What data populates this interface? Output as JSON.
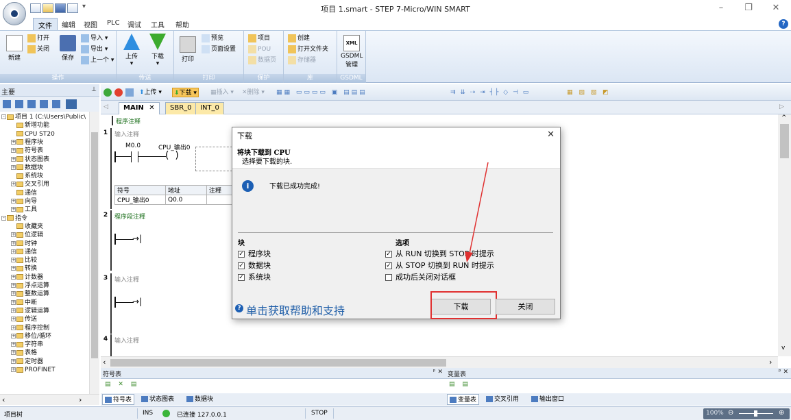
{
  "title": "项目 1.smart - STEP 7-Micro/WIN SMART",
  "menu": [
    "文件",
    "编辑",
    "视图",
    "PLC",
    "调试",
    "工具",
    "帮助"
  ],
  "ribbon": {
    "new": "新建",
    "open": "打开",
    "close": "关闭",
    "save": "保存",
    "import": "导入",
    "export": "导出",
    "prev": "上一个",
    "upload": "上传",
    "download": "下载",
    "print": "打印",
    "preview": "预览",
    "page_setup": "页面设置",
    "project": "项目",
    "pou": "POU",
    "datapage": "数据页",
    "create": "创建",
    "open_folder": "打开文件夹",
    "memcard": "存储器",
    "gsdml": "GSDML",
    "gsdml2": "管理",
    "groups": [
      "操作",
      "传送",
      "打印",
      "保护",
      "库",
      "GSDML"
    ]
  },
  "left_title": "主要",
  "tree": [
    {
      "t": "项目 1 (C:\\Users\\Public\\",
      "d": 0,
      "e": "-"
    },
    {
      "t": "新增功能",
      "d": 1
    },
    {
      "t": "CPU ST20",
      "d": 1
    },
    {
      "t": "程序块",
      "d": 1,
      "e": "+"
    },
    {
      "t": "符号表",
      "d": 1,
      "e": "+"
    },
    {
      "t": "状态图表",
      "d": 1,
      "e": "+"
    },
    {
      "t": "数据块",
      "d": 1,
      "e": "+"
    },
    {
      "t": "系统块",
      "d": 1
    },
    {
      "t": "交叉引用",
      "d": 1,
      "e": "+"
    },
    {
      "t": "通信",
      "d": 1
    },
    {
      "t": "向导",
      "d": 1,
      "e": "+"
    },
    {
      "t": "工具",
      "d": 1,
      "e": "+"
    },
    {
      "t": "指令",
      "d": 0,
      "e": "-"
    },
    {
      "t": "收藏夹",
      "d": 1
    },
    {
      "t": "位逻辑",
      "d": 1,
      "e": "+"
    },
    {
      "t": "时钟",
      "d": 1,
      "e": "+"
    },
    {
      "t": "通信",
      "d": 1,
      "e": "+"
    },
    {
      "t": "比较",
      "d": 1,
      "e": "+"
    },
    {
      "t": "转换",
      "d": 1,
      "e": "+"
    },
    {
      "t": "计数器",
      "d": 1,
      "e": "+"
    },
    {
      "t": "浮点运算",
      "d": 1,
      "e": "+"
    },
    {
      "t": "整数运算",
      "d": 1,
      "e": "+"
    },
    {
      "t": "中断",
      "d": 1,
      "e": "+"
    },
    {
      "t": "逻辑运算",
      "d": 1,
      "e": "+"
    },
    {
      "t": "传送",
      "d": 1,
      "e": "+"
    },
    {
      "t": "程序控制",
      "d": 1,
      "e": "+"
    },
    {
      "t": "移位/循环",
      "d": 1,
      "e": "+"
    },
    {
      "t": "字符串",
      "d": 1,
      "e": "+"
    },
    {
      "t": "表格",
      "d": 1,
      "e": "+"
    },
    {
      "t": "定时器",
      "d": 1,
      "e": "+"
    },
    {
      "t": "PROFINET",
      "d": 1,
      "e": "+"
    }
  ],
  "toolbar": {
    "upload": "上传",
    "download": "下载",
    "insert": "插入",
    "delete": "删除"
  },
  "tabs": [
    "MAIN",
    "SBR_0",
    "INT_0"
  ],
  "editor": {
    "prog_comment": "程序注释",
    "networks": [
      {
        "n": "1",
        "comment": "输入注释"
      },
      {
        "n": "2",
        "comment": "程序段注释"
      },
      {
        "n": "3",
        "comment": "输入注释"
      },
      {
        "n": "4",
        "comment": "输入注释"
      }
    ],
    "contact": "M0.0",
    "coil": "CPU_输出0",
    "sym_headers": [
      "符号",
      "地址",
      "注释"
    ],
    "sym_row": [
      "CPU_输出0",
      "Q0.0",
      ""
    ]
  },
  "dialog": {
    "title": "下载",
    "heading": "将块下载到 CPU",
    "sub": "选择要下载的块.",
    "message": "下载已成功完成!",
    "blocks_title": "块",
    "blocks": [
      "程序块",
      "数据块",
      "系统块"
    ],
    "options_title": "选项",
    "options": [
      {
        "label": "从 RUN 切换到 STOP 时提示",
        "checked": true
      },
      {
        "label": "从 STOP 切换到 RUN 时提示",
        "checked": true
      },
      {
        "label": "成功后关闭对话框",
        "checked": false
      }
    ],
    "help": "单击获取帮助和支持",
    "download_btn": "下载",
    "close_btn": "关闭"
  },
  "panes": {
    "sym_title": "符号表",
    "var_title": "变量表",
    "left_tabs": [
      "符号表",
      "状态图表",
      "数据块"
    ],
    "right_tabs": [
      "变量表",
      "交叉引用",
      "输出窗口"
    ]
  },
  "status": {
    "tree": "项目树",
    "mode": "INS",
    "conn": "已连接 127.0.0.1",
    "run": "STOP",
    "zoom": "100%"
  }
}
